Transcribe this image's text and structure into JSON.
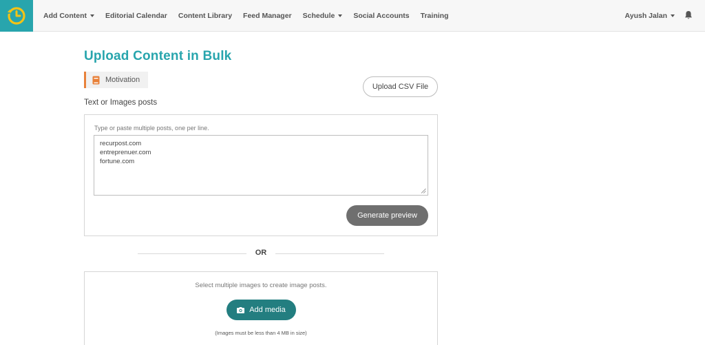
{
  "nav": {
    "items": [
      {
        "label": "Add Content",
        "dropdown": true
      },
      {
        "label": "Editorial Calendar",
        "dropdown": false
      },
      {
        "label": "Content Library",
        "dropdown": false
      },
      {
        "label": "Feed Manager",
        "dropdown": false
      },
      {
        "label": "Schedule",
        "dropdown": true
      },
      {
        "label": "Social Accounts",
        "dropdown": false
      },
      {
        "label": "Training",
        "dropdown": false
      }
    ],
    "user_name": "Ayush Jalan",
    "logo_icon": "clock-logo-icon",
    "notification_icon": "bell-icon"
  },
  "page": {
    "title": "Upload Content in Bulk",
    "category": {
      "label": "Motivation",
      "icon": "book-icon",
      "color": "#e8813a"
    },
    "upload_csv_label": "Upload CSV File",
    "section_label": "Text or Images posts"
  },
  "text_posts": {
    "hint": "Type or paste multiple posts, one per line.",
    "lines": [
      "recurpost.com",
      "entreprenuer.com",
      "fortune.com"
    ],
    "generate_label": "Generate preview"
  },
  "divider": {
    "or_label": "OR"
  },
  "media": {
    "hint": "Select multiple images to create image posts.",
    "add_media_label": "Add media",
    "add_media_icon": "camera-icon",
    "size_note": "(Images must be less than 4 MB in size)"
  },
  "colors": {
    "brand": "#28a5ad",
    "add_media_bg": "#237e80",
    "generate_bg": "#6f6f6f"
  }
}
